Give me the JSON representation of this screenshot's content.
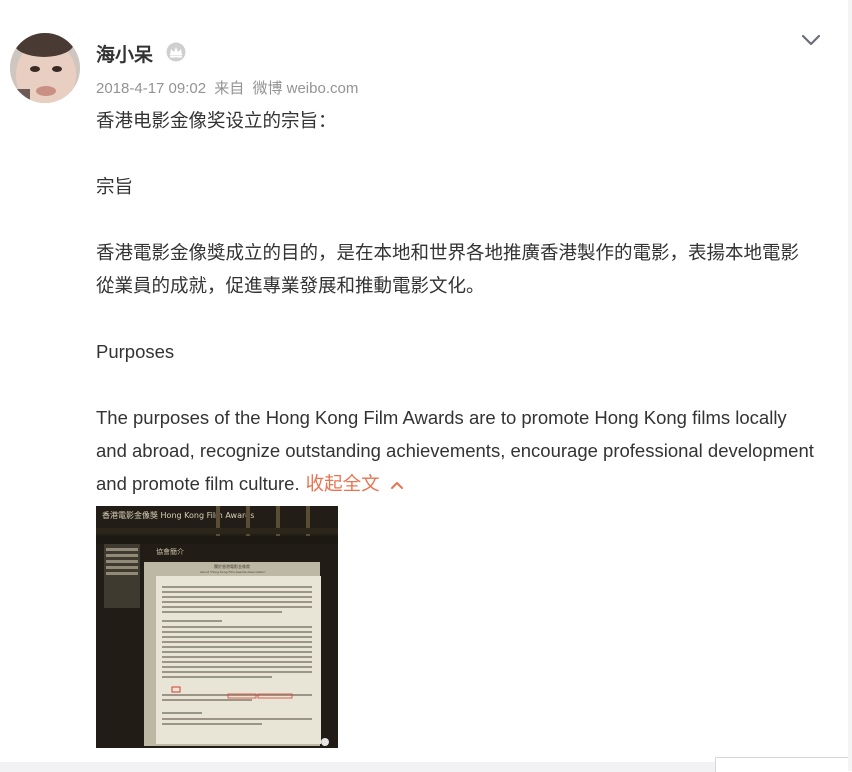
{
  "post": {
    "username": "海小呆",
    "timestamp": "2018-4-17 09:02",
    "source_prefix": "来自",
    "source": "微博 weibo.com",
    "paragraphs": {
      "p1": "香港电影金像奖设立的宗旨：",
      "p2": "宗旨",
      "p3": "香港電影金像獎成立的目的，是在本地和世界各地推廣香港製作的電影，表揚本地電影從業員的成就，促進專業發展和推動電影文化。",
      "p4": "Purposes",
      "p5": "The purposes of the Hong Kong Film Awards are to promote Hong Kong films locally and abroad, recognize outstanding achievements, encourage professional development and promote film culture."
    },
    "collapse_label": "收起全文",
    "image": {
      "site_title": "香港電影金像獎 Hong Kong Film Awards",
      "section_title": "協會簡介",
      "heading_zh": "關於香港電影金像獎",
      "heading_en": "About \"Hong Kong Film Awards Association\""
    }
  },
  "colors": {
    "accent": "#eb7350",
    "meta": "#939393",
    "text": "#333333"
  },
  "icons": {
    "badge": "crown-icon",
    "menu": "chevron-down-icon",
    "collapse": "chevron-up-icon"
  }
}
